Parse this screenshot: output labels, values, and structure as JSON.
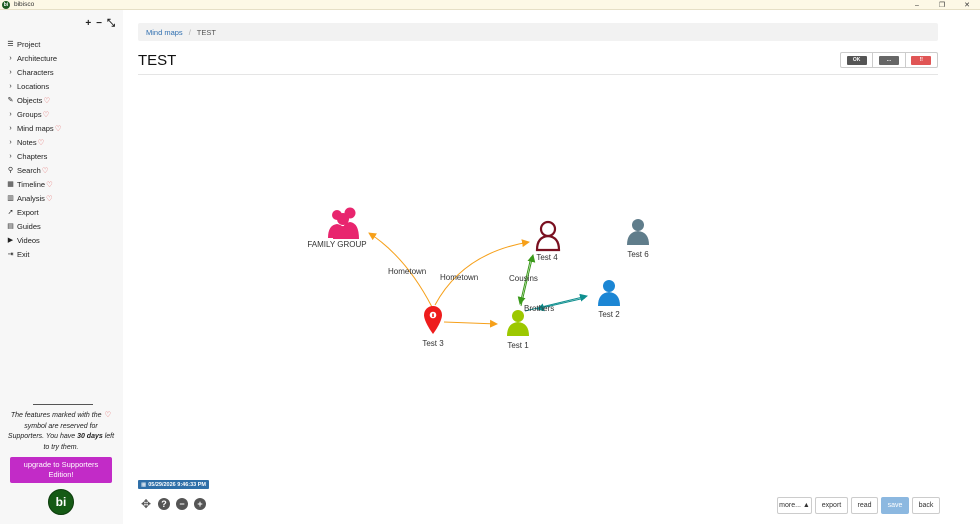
{
  "window": {
    "app_logo": "bi",
    "title": "bibisco",
    "controls": {
      "minimize": "–",
      "maximize": "❐",
      "close": "✕"
    }
  },
  "sidebar": {
    "tools": {
      "add": "+",
      "remove": "−",
      "collapse": "⤡"
    },
    "items": [
      {
        "label": "Project",
        "icon": "project-list-icon",
        "glyph": "☰",
        "heart": false
      },
      {
        "label": "Architecture",
        "icon": "chevron-right-icon",
        "glyph": "›",
        "heart": false
      },
      {
        "label": "Characters",
        "icon": "chevron-right-icon",
        "glyph": "›",
        "heart": false
      },
      {
        "label": "Locations",
        "icon": "chevron-right-icon",
        "glyph": "›",
        "heart": false
      },
      {
        "label": "Objects",
        "icon": "wand-icon",
        "glyph": "✎",
        "heart": true
      },
      {
        "label": "Groups",
        "icon": "chevron-right-icon",
        "glyph": "›",
        "heart": true
      },
      {
        "label": "Mind maps",
        "icon": "chevron-right-icon",
        "glyph": "›",
        "heart": true
      },
      {
        "label": "Notes",
        "icon": "chevron-right-icon",
        "glyph": "›",
        "heart": true
      },
      {
        "label": "Chapters",
        "icon": "chevron-right-icon",
        "glyph": "›",
        "heart": false
      },
      {
        "label": "Search",
        "icon": "search-icon",
        "glyph": "⚲",
        "heart": true
      },
      {
        "label": "Timeline",
        "icon": "calendar-icon",
        "glyph": "▦",
        "heart": true
      },
      {
        "label": "Analysis",
        "icon": "bar-chart-icon",
        "glyph": "▥",
        "heart": true
      },
      {
        "label": "Export",
        "icon": "paper-plane-icon",
        "glyph": "➚",
        "heart": false
      },
      {
        "label": "Guides",
        "icon": "book-icon",
        "glyph": "▤",
        "heart": false
      },
      {
        "label": "Videos",
        "icon": "video-icon",
        "glyph": "▶",
        "heart": false
      },
      {
        "label": "Exit",
        "icon": "exit-icon",
        "glyph": "⇥",
        "heart": false
      }
    ],
    "note_part1": "The features marked with the",
    "note_part2": "symbol are reserved for Supporters. You have",
    "note_days": "30 days",
    "note_part3": "left to try them.",
    "upgrade_label": "upgrade to Supporters Edition!",
    "logo_text": "bi"
  },
  "breadcrumb": {
    "link": "Mind maps",
    "separator": "/",
    "current": "TEST"
  },
  "page_title": "TEST",
  "actions": {
    "ok": "OK",
    "more": "...",
    "delete": "!!"
  },
  "colors": {
    "group": "#e8256e",
    "location": "#ee1c1c",
    "character_hollow": "#7a1020",
    "character_green": "#9cc800",
    "character_blue": "#1c86d4",
    "character_gray": "#607d8b",
    "edge_orange": "#f6a01a",
    "edge_green": "#3a9a1a",
    "edge_teal": "#0f8f8f"
  },
  "mindmap": {
    "nodes": [
      {
        "id": "family",
        "label": "FAMILY GROUP",
        "kind": "group",
        "icon": "group-icon"
      },
      {
        "id": "test3",
        "label": "Test 3",
        "kind": "location",
        "icon": "map-pin-icon"
      },
      {
        "id": "test4",
        "label": "Test 4",
        "kind": "character-hollow",
        "icon": "user-outline-icon"
      },
      {
        "id": "test1",
        "label": "Test 1",
        "kind": "character-green",
        "icon": "user-icon"
      },
      {
        "id": "test2",
        "label": "Test 2",
        "kind": "character-blue",
        "icon": "user-icon"
      },
      {
        "id": "test6",
        "label": "Test 6",
        "kind": "character-gray",
        "icon": "user-icon"
      }
    ],
    "edges": [
      {
        "from": "test3",
        "to": "family",
        "label": "Hometown",
        "color": "edge_orange"
      },
      {
        "from": "test3",
        "to": "test4",
        "label": "Hometown",
        "color": "edge_orange"
      },
      {
        "from": "test3",
        "to": "test1",
        "label": "",
        "color": "edge_orange"
      },
      {
        "from": "test4",
        "to": "test1",
        "label": "Cousins",
        "color": "edge_green"
      },
      {
        "from": "test1",
        "to": "test2",
        "label": "Brothers",
        "color": "edge_teal"
      }
    ]
  },
  "timestamp": "05/29/2026 9:46:33 PM",
  "zoom": {
    "move": "✥",
    "help": "?",
    "zoom_out": "−",
    "zoom_in": "+"
  },
  "buttons": {
    "more": "more... ▲",
    "export": "export",
    "read": "read",
    "save": "save",
    "back": "back"
  }
}
